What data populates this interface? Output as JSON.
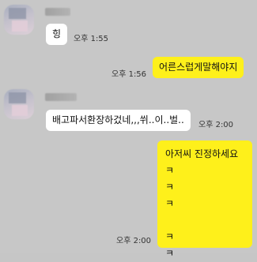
{
  "messages": [
    {
      "sender": "them",
      "text": "힝",
      "time": "오후 1:55"
    },
    {
      "sender": "me",
      "text": "어른스럽게말해야지",
      "time": "오후 1:56"
    },
    {
      "sender": "them",
      "text": "배고파서환장하겄네,,,쒸..이..벌..",
      "time": "오후 2:00"
    },
    {
      "sender": "me",
      "lines": [
        "아저씨 진정하세요",
        "ㅋ",
        "ㅋ",
        "ㅋ",
        "",
        "ㅋ",
        "ㅋ"
      ],
      "time": "오후 2:00"
    }
  ],
  "colors": {
    "background": "#c7c7c7",
    "incoming_bubble": "#ffffff",
    "outgoing_bubble": "#fef01b"
  }
}
